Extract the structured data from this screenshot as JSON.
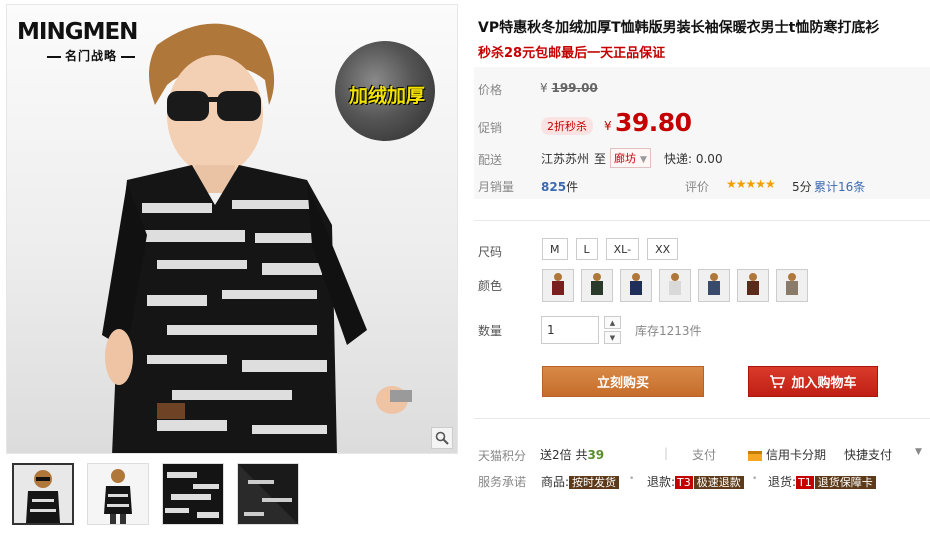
{
  "gallery": {
    "brand_name": "MINGMEN",
    "brand_tagline": "名门战略",
    "fleece_badge": "加绒加厚",
    "thumbnail_count": 4
  },
  "product": {
    "title": "VP特惠秋冬加绒加厚T恤韩版男装长袖保暖衣男士t恤防寒打底衫",
    "subtitle": "秒杀28元包邮最后一天正品保证"
  },
  "price": {
    "label": "价格",
    "original_currency": "¥",
    "original_value": "199.00",
    "promo_label": "促销",
    "promo_tag": "2折秒杀",
    "promo_currency": "¥",
    "promo_value": "39.80"
  },
  "shipping": {
    "label": "配送",
    "origin": "江苏苏州",
    "to": "至",
    "destination": "廊坊",
    "express": "快递: 0.00"
  },
  "sales": {
    "label": "月销量",
    "count": "825",
    "unit": "件",
    "rating_label": "评价",
    "stars": "★★★★★",
    "rating_score": 5,
    "score_text": "5分",
    "reviews_text": "累计16条"
  },
  "options": {
    "size_label": "尺码",
    "sizes": [
      "M",
      "L",
      "XL-",
      "XX"
    ],
    "color_label": "颜色",
    "color_count": 7
  },
  "quantity": {
    "label": "数量",
    "value": "1",
    "stock": "库存1213件"
  },
  "actions": {
    "buy_now": "立刻购买",
    "add_to_cart": "加入购物车"
  },
  "points": {
    "label": "天猫积分",
    "text_prefix": "送2倍 共",
    "amount": "39"
  },
  "payment": {
    "label": "支付",
    "credit": "信用卡分期",
    "quick": "快捷支付"
  },
  "services": {
    "label": "服务承诺",
    "goods_label": "商品:",
    "goods_tag": "按时发货",
    "refund_label": "退款:",
    "refund_code": "T3",
    "refund_tag": "极速退款",
    "return_label": "退货:",
    "return_code": "T1",
    "return_tag": "退货保障卡"
  },
  "colors": {
    "accent_red": "#c40000",
    "buy_button": "#c66d2b",
    "cart_button": "#c11f14",
    "link_blue": "#3c6ab0",
    "star_gold": "#f2a000"
  }
}
